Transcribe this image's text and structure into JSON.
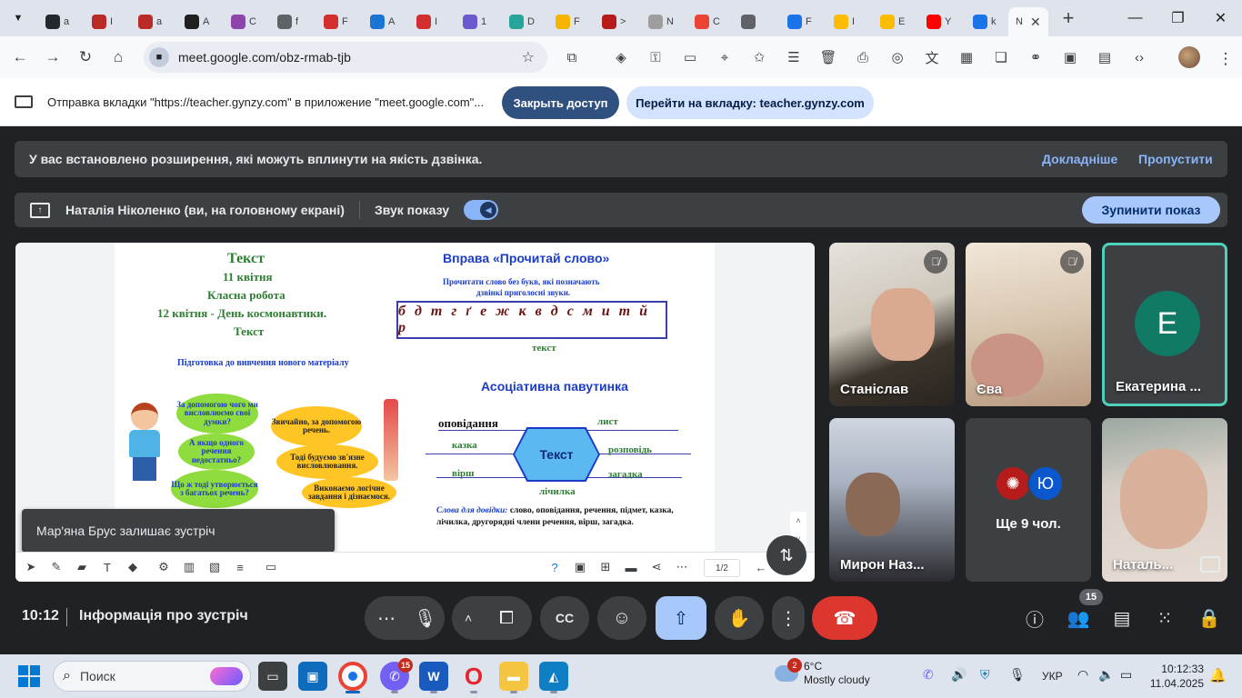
{
  "browser": {
    "tabs": [
      {
        "icon": "github-icon",
        "color": "#24292f",
        "label": "a"
      },
      {
        "icon": "quora-icon",
        "color": "#b92b27",
        "label": "I"
      },
      {
        "icon": "quora-icon",
        "color": "#b92b27",
        "label": "a"
      },
      {
        "icon": "adobe-icon",
        "color": "#1f1f1f",
        "label": "A"
      },
      {
        "icon": "hexagon-icon",
        "color": "#8e44ad",
        "label": "C"
      },
      {
        "icon": "globe-icon",
        "color": "#5f6368",
        "label": "f"
      },
      {
        "icon": "opera-icon",
        "color": "#d32f2f",
        "label": "F"
      },
      {
        "icon": "puzzle-icon",
        "color": "#1976d2",
        "label": "A"
      },
      {
        "icon": "opera-icon",
        "color": "#d32f2f",
        "label": "I"
      },
      {
        "icon": "app-icon",
        "color": "#6a5acd",
        "label": "1"
      },
      {
        "icon": "d-icon",
        "color": "#26a69a",
        "label": "D"
      },
      {
        "icon": "classroom-icon",
        "color": "#f4b400",
        "label": "F"
      },
      {
        "icon": "fi-icon",
        "color": "#b71c1c",
        "label": ">"
      },
      {
        "icon": "paper-icon",
        "color": "#9e9e9e",
        "label": "N"
      },
      {
        "icon": "gmail-icon",
        "color": "#ea4335",
        "label": "C"
      },
      {
        "icon": "generic-icon",
        "color": "#5f6368",
        "label": ""
      },
      {
        "icon": "grid-icon",
        "color": "#1a73e8",
        "label": "F"
      },
      {
        "icon": "bell-icon",
        "color": "#fbbc04",
        "label": "I"
      },
      {
        "icon": "bell-icon",
        "color": "#fbbc04",
        "label": "E"
      },
      {
        "icon": "youtube-icon",
        "color": "#ff0000",
        "label": "Y"
      },
      {
        "icon": "extension-icon",
        "color": "#1a73e8",
        "label": "k"
      }
    ],
    "active_tab_label": "N",
    "url": "meet.google.com/obz-rmab-tjb"
  },
  "infobar": {
    "text": "Отправка вкладки \"https://teacher.gynzy.com\" в приложение \"meet.google.com\"...",
    "stop_label": "Закрыть доступ",
    "switch_label": "Перейти на вкладку: teacher.gynzy.com"
  },
  "notice": {
    "text": "У вас встановлено розширення, які можуть вплинути на якість дзвінка.",
    "learn_more": "Докладніше",
    "dismiss": "Пропустити"
  },
  "presenting": {
    "name": "Наталія Ніколенко (ви, на головному екрані)",
    "sound_label": "Звук показу",
    "sound_on": true,
    "stop_label": "Зупинити показ"
  },
  "slide": {
    "left_title": "Текст",
    "date1": "11 квітня",
    "classwork": "Класна робота",
    "date2": "12 квітня - День космонавтики.",
    "subtitle": "Текст",
    "prep": "Підготовка до вивчення нового матеріалу",
    "bubbles": [
      "За допомогою чого ми висловлюємо свої думки?",
      "А якщо одного речення недостатньо?",
      "Що ж тоді утворюється з багатьох речень?",
      "Звичайно, за допомогою речень.",
      "Тоді будуємо зв'язне висловлювання.",
      "Виконаємо логічне завдання і дізнаємося."
    ],
    "exercise_title": "Вправа «Прочитай слово»",
    "exercise_instr1": "Прочитати слово без букв, які позначають",
    "exercise_instr2": "дзвінкі приголосні звуки.",
    "letters": "б д т г ґ е ж к в д с м и т й р",
    "answer": "текст",
    "web_title": "Асоціативна павутинка",
    "web_center": "Текст",
    "web_words": [
      "оповідання",
      "лист",
      "казка",
      "розповідь",
      "вірш",
      "загадка",
      "лічилка"
    ],
    "hint_label": "Слова для довідки:",
    "hint_text1": "слово, оповідання, речення, підмет, казка,",
    "hint_text2": "лічилка, другорядні члени речення, вірш, загадка."
  },
  "whiteboard": {
    "page": "1/2"
  },
  "toast": "Мар'яна Брус залишає зустріч",
  "participants": [
    {
      "name": "Станіслав",
      "muted": true
    },
    {
      "name": "Єва",
      "muted": true
    },
    {
      "name": "Екатерина ...",
      "initial": "E",
      "active": true
    },
    {
      "name": "Мирон Наз..."
    },
    {
      "more_label": "Ще 9 чол.",
      "avatar_initial": "Ю"
    },
    {
      "name": "Наталь..."
    }
  ],
  "controls": {
    "time": "10:12",
    "meeting_info": "Інформація про зустріч",
    "participant_count": "15"
  },
  "taskbar": {
    "search_label": "Поиск",
    "viber_badge": "15",
    "weather_badge": "2",
    "temperature": "6°C",
    "weather_desc": "Mostly cloudy",
    "language": "УКР",
    "time": "10:12:33",
    "date": "11.04.2025"
  }
}
